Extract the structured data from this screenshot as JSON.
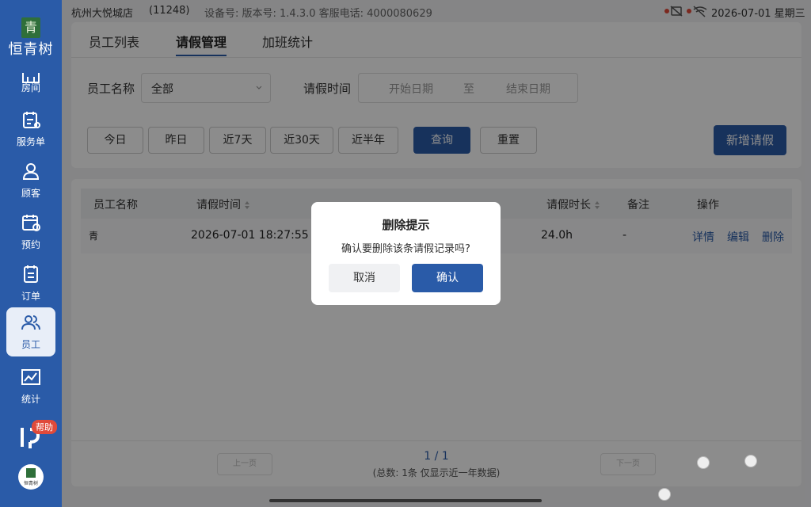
{
  "sidebar": {
    "logo_char": "青",
    "logo_text": "恒青树",
    "items": [
      {
        "label": "房间",
        "icon": "room-icon"
      },
      {
        "label": "服务单",
        "icon": "service-order-icon"
      },
      {
        "label": "顾客",
        "icon": "customer-icon"
      },
      {
        "label": "预约",
        "icon": "calendar-icon"
      },
      {
        "label": "订单",
        "icon": "order-icon"
      },
      {
        "label": "员工",
        "icon": "staff-icon",
        "active": true
      },
      {
        "label": "统计",
        "icon": "chart-icon"
      }
    ],
    "help_badge": "帮助",
    "brand_small": "恒青树"
  },
  "topbar": {
    "store": "杭州大悦城店",
    "code": "(11248)",
    "device": "设备号: 版本号: 1.4.3.0 客服电话: 4000080629",
    "datetime": "2026-07-01 星期三"
  },
  "tabs": [
    {
      "label": "员工列表"
    },
    {
      "label": "请假管理",
      "active": true
    },
    {
      "label": "加班统计"
    }
  ],
  "filters": {
    "employee_label": "员工名称",
    "employee_value": "全部",
    "time_label": "请假时间",
    "start_placeholder": "开始日期",
    "to": "至",
    "end_placeholder": "结束日期"
  },
  "quick_ranges": [
    "今日",
    "昨日",
    "近7天",
    "近30天",
    "近半年"
  ],
  "buttons": {
    "query": "查询",
    "reset": "重置",
    "add": "新增请假"
  },
  "table": {
    "headers": [
      "员工名称",
      "请假时间",
      "请假时长",
      "备注",
      "操作"
    ],
    "row": {
      "name": "青",
      "time": "2026-07-01 18:27:55 -",
      "duration": "24.0h",
      "note": "-",
      "ops": [
        "详情",
        "编辑",
        "删除"
      ]
    }
  },
  "pager": {
    "prev": "上一页",
    "next": "下一页",
    "count": "1 / 1",
    "total": "(总数: 1条 仅显示近一年数据)"
  },
  "modal": {
    "title": "删除提示",
    "message": "确认要删除该条请假记录吗?",
    "cancel": "取消",
    "confirm": "确认"
  },
  "colors": {
    "primary": "#2a5ba8",
    "sidebar": "#2a5ba8",
    "danger": "#e04a3a"
  }
}
